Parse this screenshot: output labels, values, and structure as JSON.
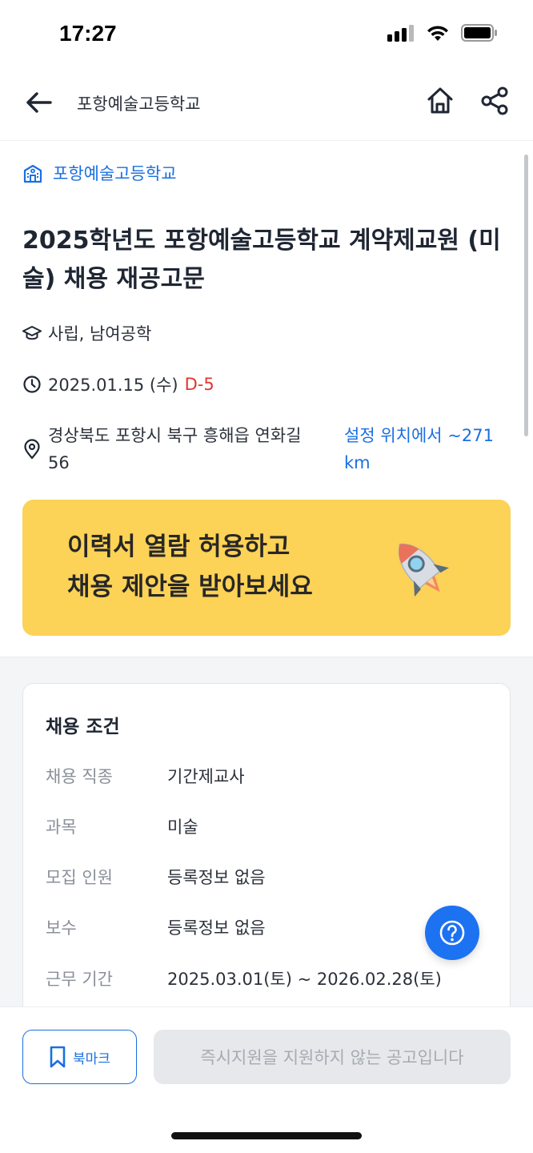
{
  "status": {
    "time": "17:27"
  },
  "header": {
    "title": "포항예술고등학교"
  },
  "post": {
    "school_link": "포항예술고등학교",
    "title": "2025학년도 포항예술고등학교 계약제교원 (미술) 채용 재공고문",
    "school_type": "사립, 남여공학",
    "deadline": "2025.01.15 (수)",
    "dday": "D-5",
    "address": "경상북도 포항시 북구 흥해읍 연화길 56",
    "distance": "설정 위치에서 ~271 km"
  },
  "banner": {
    "line1": "이력서 열람 허용하고",
    "line2": "채용 제안을 받아보세요"
  },
  "conditions": {
    "title": "채용 조건",
    "rows": [
      {
        "label": "채용 직종",
        "value": "기간제교사"
      },
      {
        "label": "과목",
        "value": "미술"
      },
      {
        "label": "모집 인원",
        "value": "등록정보 없음"
      },
      {
        "label": "보수",
        "value": "등록정보 없음"
      },
      {
        "label": "근무 기간",
        "value": "2025.03.01(토) ~ 2026.02.28(토)"
      }
    ]
  },
  "bottom": {
    "bookmark_label": "북마크",
    "apply_label": "즉시지원을 지원하지 않는 공고입니다"
  },
  "colors": {
    "accent": "#1b6fe0",
    "dday": "#e3342f",
    "banner": "#fcd257",
    "fab": "#1d72f2"
  }
}
